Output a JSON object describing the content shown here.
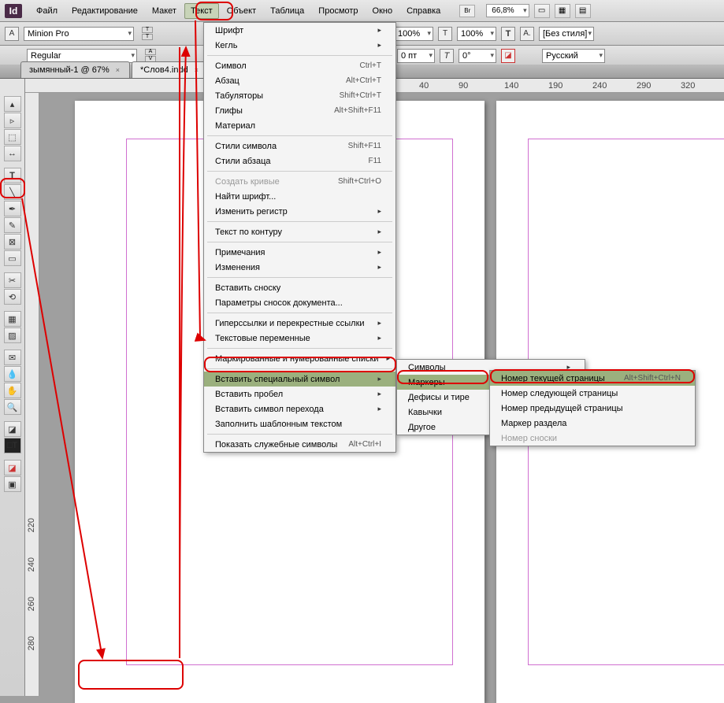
{
  "menubar": {
    "items": [
      "Файл",
      "Редактирование",
      "Макет",
      "Текст",
      "Объект",
      "Таблица",
      "Просмотр",
      "Окно",
      "Справка"
    ],
    "active_index": 3,
    "zoom": "66,8%",
    "br": "Br"
  },
  "optbar": {
    "font": "Minion Pro",
    "weight": "Regular",
    "scaleH": "100%",
    "scaleV": "100%",
    "kern": "0 пт",
    "style": "[Без стиля]",
    "lang": "Русский"
  },
  "tabs": [
    {
      "label": "зымянный-1 @ 67%",
      "active": false
    },
    {
      "label": "*Cлов4.indd",
      "active": true
    }
  ],
  "ruler_h": [
    "40",
    "90",
    "140",
    "190",
    "240",
    "290",
    "320"
  ],
  "ruler_v": [
    "220",
    "240",
    "260",
    "280"
  ],
  "menu1": [
    {
      "t": "Шрифт",
      "a": true
    },
    {
      "t": "Кегль",
      "a": true
    },
    {
      "sep": true
    },
    {
      "t": "Символ",
      "sc": "Ctrl+T"
    },
    {
      "t": "Абзац",
      "sc": "Alt+Ctrl+T"
    },
    {
      "t": "Табуляторы",
      "sc": "Shift+Ctrl+T"
    },
    {
      "t": "Глифы",
      "sc": "Alt+Shift+F11"
    },
    {
      "t": "Материал"
    },
    {
      "sep": true
    },
    {
      "t": "Стили символа",
      "sc": "Shift+F11"
    },
    {
      "t": "Стили абзаца",
      "sc": "F11"
    },
    {
      "sep": true
    },
    {
      "t": "Создать кривые",
      "sc": "Shift+Ctrl+O",
      "dis": true
    },
    {
      "t": "Найти шрифт..."
    },
    {
      "t": "Изменить регистр",
      "a": true
    },
    {
      "sep": true
    },
    {
      "t": "Текст по контуру",
      "a": true
    },
    {
      "sep": true
    },
    {
      "t": "Примечания",
      "a": true
    },
    {
      "t": "Изменения",
      "a": true
    },
    {
      "sep": true
    },
    {
      "t": "Вставить сноску"
    },
    {
      "t": "Параметры сносок документа..."
    },
    {
      "sep": true
    },
    {
      "t": "Гиперссылки и перекрестные ссылки",
      "a": true
    },
    {
      "t": "Текстовые переменные",
      "a": true
    },
    {
      "sep": true
    },
    {
      "t": "Маркированные и нумерованные списки",
      "a": true
    },
    {
      "sep": true
    },
    {
      "t": "Вставить специальный символ",
      "a": true,
      "sel": true
    },
    {
      "t": "Вставить пробел",
      "a": true
    },
    {
      "t": "Вставить символ перехода",
      "a": true
    },
    {
      "t": "Заполнить шаблонным текстом"
    },
    {
      "sep": true
    },
    {
      "t": "Показать служебные символы",
      "sc": "Alt+Ctrl+I"
    }
  ],
  "menu2": [
    {
      "t": "Символы",
      "a": true
    },
    {
      "t": "Маркеры",
      "a": true,
      "sel": true
    },
    {
      "t": "Дефисы и тире",
      "a": true
    },
    {
      "t": "Кавычки",
      "a": true
    },
    {
      "t": "Другое",
      "a": true
    }
  ],
  "menu3": [
    {
      "t": "Номер текущей страницы",
      "sc": "Alt+Shift+Ctrl+N",
      "sel": true
    },
    {
      "t": "Номер следующей страницы"
    },
    {
      "t": "Номер предыдущей страницы"
    },
    {
      "t": "Маркер раздела"
    },
    {
      "t": "Номер сноски",
      "dis": true
    }
  ]
}
